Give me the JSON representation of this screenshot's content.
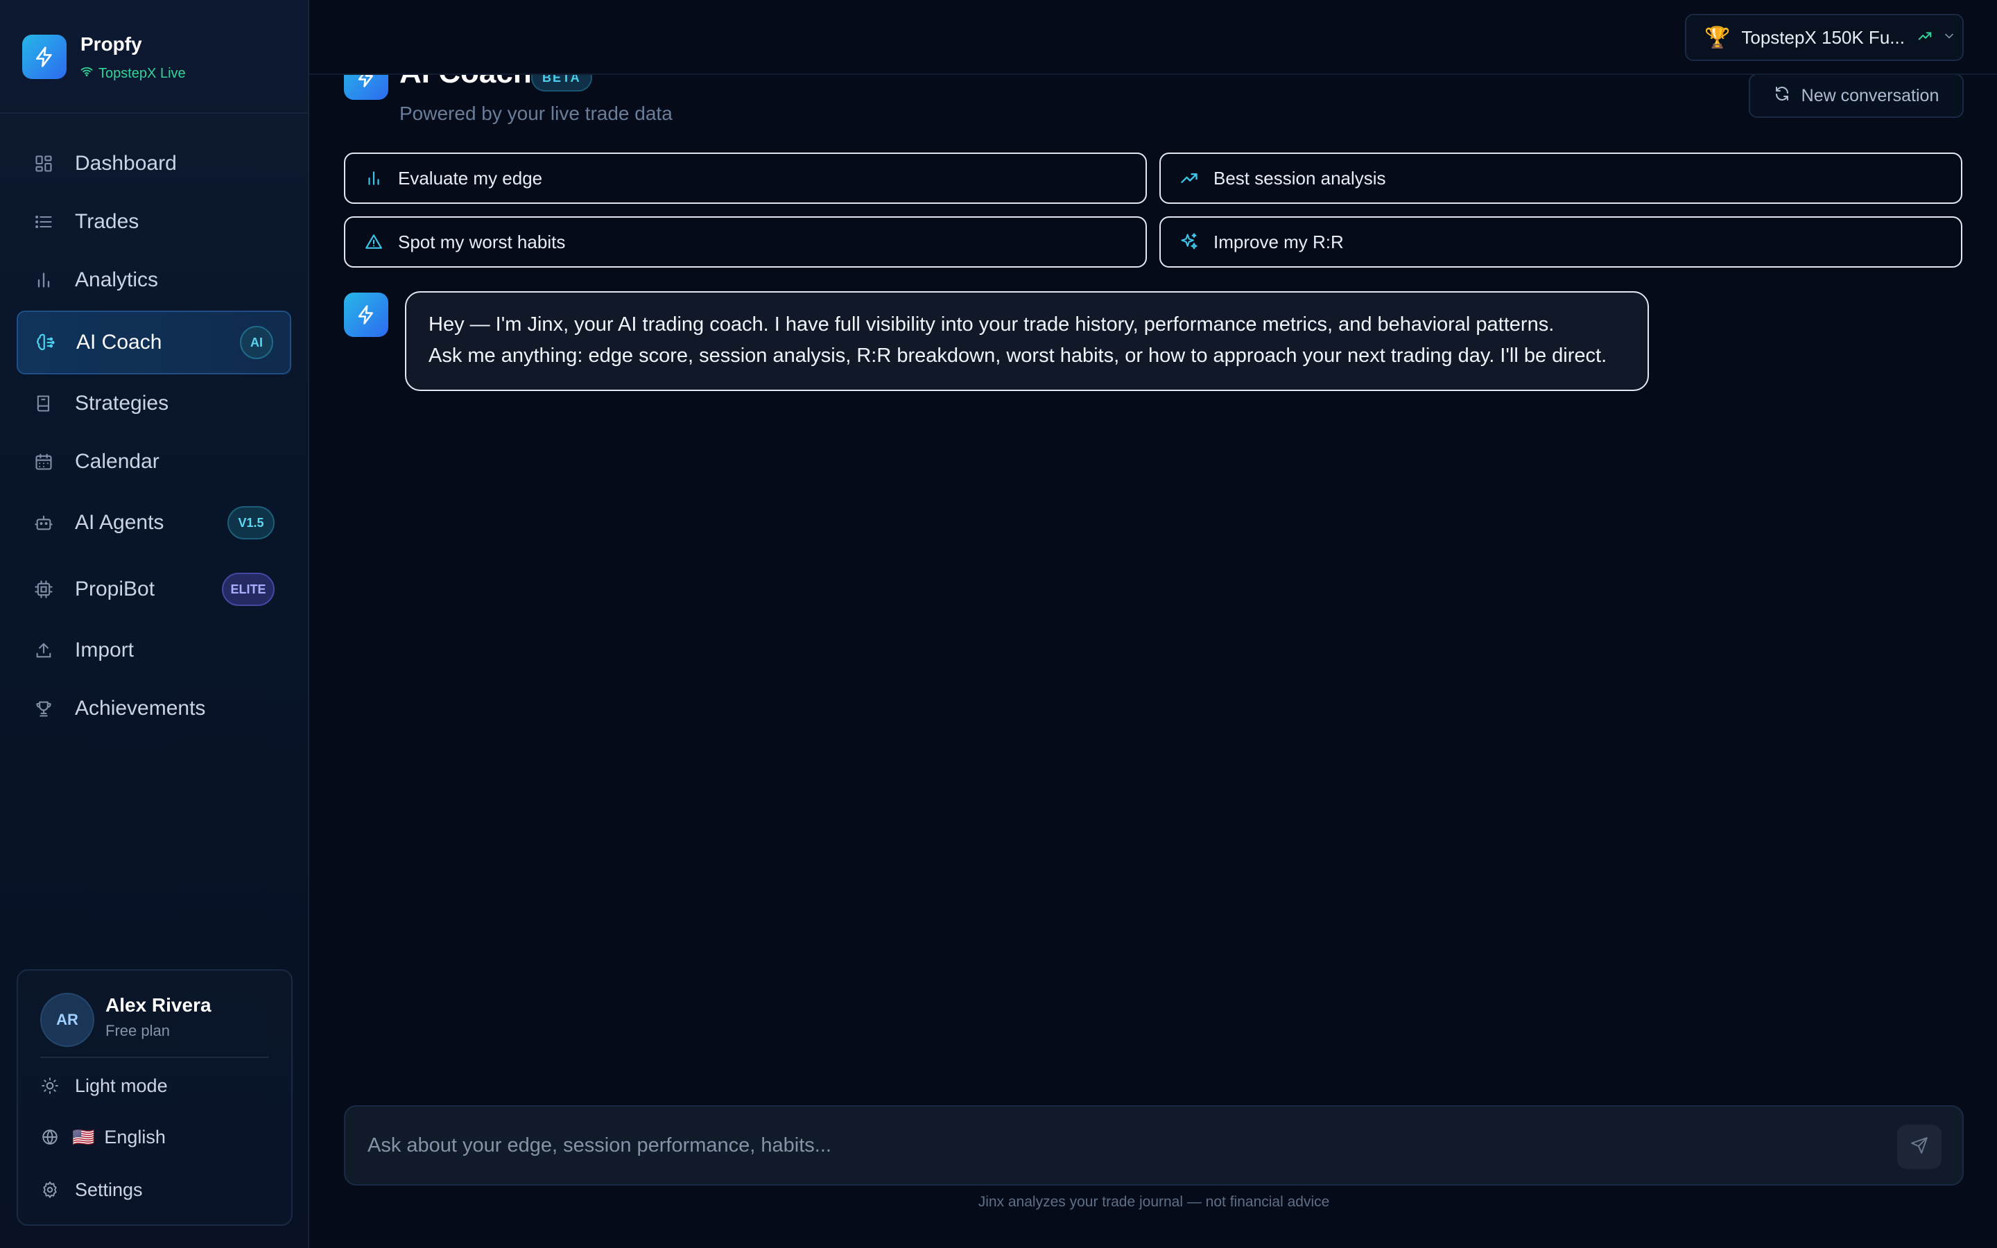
{
  "sidebar": {
    "brand_name": "Propfy",
    "brand_status": "TopstepX Live",
    "items": [
      {
        "label": "Dashboard",
        "icon": "dashboard-icon"
      },
      {
        "label": "Trades",
        "icon": "list-icon"
      },
      {
        "label": "Analytics",
        "icon": "bar-chart-icon"
      },
      {
        "label": "AI Coach",
        "icon": "brain-icon",
        "badge": "AI",
        "active": true
      },
      {
        "label": "Strategies",
        "icon": "book-icon"
      },
      {
        "label": "Calendar",
        "icon": "calendar-icon"
      },
      {
        "label": "AI Agents",
        "icon": "robot-icon",
        "badge": "V1.5"
      },
      {
        "label": "PropiBot",
        "icon": "cpu-icon",
        "badge": "ELITE"
      },
      {
        "label": "Import",
        "icon": "upload-icon"
      },
      {
        "label": "Achievements",
        "icon": "trophy-icon"
      }
    ],
    "user": {
      "initials": "AR",
      "name": "Alex Rivera",
      "plan": "Free plan",
      "theme_label": "Light mode",
      "language_flag": "🇺🇸",
      "language_label": "English",
      "settings_label": "Settings"
    }
  },
  "topbar": {
    "account_label": "TopstepX 150K Fu...",
    "account_icon": "🏆"
  },
  "main": {
    "title": "AI Coach",
    "beta_badge": "BETA",
    "subtitle": "Powered by your live trade data",
    "new_conversation_label": "New conversation",
    "quick_actions": [
      {
        "label": "Evaluate my edge",
        "icon": "bar-chart-icon"
      },
      {
        "label": "Best session analysis",
        "icon": "trending-up-icon"
      },
      {
        "label": "Spot my worst habits",
        "icon": "warning-icon"
      },
      {
        "label": "Improve my R:R",
        "icon": "sparkles-icon"
      }
    ],
    "messages": [
      {
        "role": "assistant",
        "line1": "Hey — I'm Jinx, your AI trading coach. I have full visibility into your trade history, performance metrics, and behavioral patterns.",
        "line2": "Ask me anything: edge score, session analysis, R:R breakdown, worst habits, or how to approach your next trading day. I'll be direct."
      }
    ],
    "composer_placeholder": "Ask about your edge, session performance, habits...",
    "disclaimer": "Jinx analyzes your trade journal — not financial advice"
  },
  "colors": {
    "accent": "#2bb8e6",
    "brand_gradient_start": "#27b7e8",
    "brand_gradient_end": "#2d6bf0",
    "live_status": "#34d399",
    "trophy": "#f5b400",
    "background": "#050b18"
  }
}
